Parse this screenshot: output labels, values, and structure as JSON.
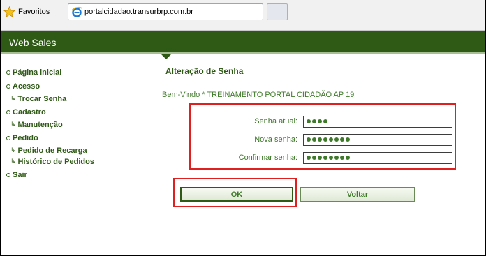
{
  "browser": {
    "favorites_label": "Favoritos",
    "tab_title": "portalcidadao.transurbrp.com.br"
  },
  "header": {
    "title": "Web Sales",
    "background": "#2f5a16"
  },
  "sidebar": {
    "items": [
      {
        "label": "Página inicial",
        "subitems": []
      },
      {
        "label": "Acesso",
        "subitems": [
          "Trocar Senha"
        ]
      },
      {
        "label": "Cadastro",
        "subitems": [
          "Manutenção"
        ]
      },
      {
        "label": "Pedido",
        "subitems": [
          "Pedido de Recarga",
          "Histórico de Pedidos"
        ]
      },
      {
        "label": "Sair",
        "subitems": []
      }
    ]
  },
  "main": {
    "title": "Alteração de Senha",
    "welcome": "Bem-Vindo * TREINAMENTO PORTAL CIDADÃO AP 19",
    "fields": [
      {
        "label": "Senha atual:",
        "masked_length": 4
      },
      {
        "label": "Nova senha:",
        "masked_length": 8
      },
      {
        "label": "Confirmar senha:",
        "masked_length": 8
      }
    ],
    "buttons": {
      "ok": "OK",
      "back": "Voltar"
    }
  },
  "colors": {
    "accent": "#2f5a16",
    "text_green": "#3f7a2a",
    "highlight": "#e02020"
  }
}
